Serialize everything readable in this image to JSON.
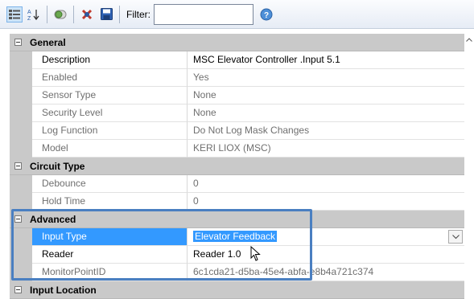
{
  "toolbar": {
    "filter_label": "Filter:",
    "buttons": [
      "categorized-icon",
      "alphabetical-icon",
      "toggle-icon",
      "clear-icon",
      "save-icon",
      "help-icon"
    ],
    "accent": "#3399ff"
  },
  "grid": {
    "categories": [
      {
        "title": "General",
        "items": [
          {
            "name": "Description",
            "value": "MSC Elevator Controller .Input 5.1",
            "dim": false
          },
          {
            "name": "Enabled",
            "value": "Yes",
            "dim": true
          },
          {
            "name": "Sensor Type",
            "value": "None",
            "dim": true
          },
          {
            "name": "Security Level",
            "value": "None",
            "dim": true
          },
          {
            "name": "Log Function",
            "value": "Do Not Log Mask Changes",
            "dim": true
          },
          {
            "name": "Model",
            "value": "KERI LIOX (MSC)",
            "dim": true
          }
        ]
      },
      {
        "title": "Circuit Type",
        "items": [
          {
            "name": "Debounce",
            "value": "0",
            "dim": true
          },
          {
            "name": "Hold Time",
            "value": "0",
            "dim": true
          }
        ]
      },
      {
        "title": "Advanced",
        "items": [
          {
            "name": "Input Type",
            "value": "Elevator Feedback",
            "selected": true
          },
          {
            "name": "Reader",
            "value": "Reader 1.0",
            "dim": false
          },
          {
            "name": "MonitorPointID",
            "value": "6c1cda21-d5ba-45e4-abfa-e8b4a721c374",
            "dim": true
          }
        ]
      },
      {
        "title": "Input Location",
        "items": []
      }
    ]
  }
}
